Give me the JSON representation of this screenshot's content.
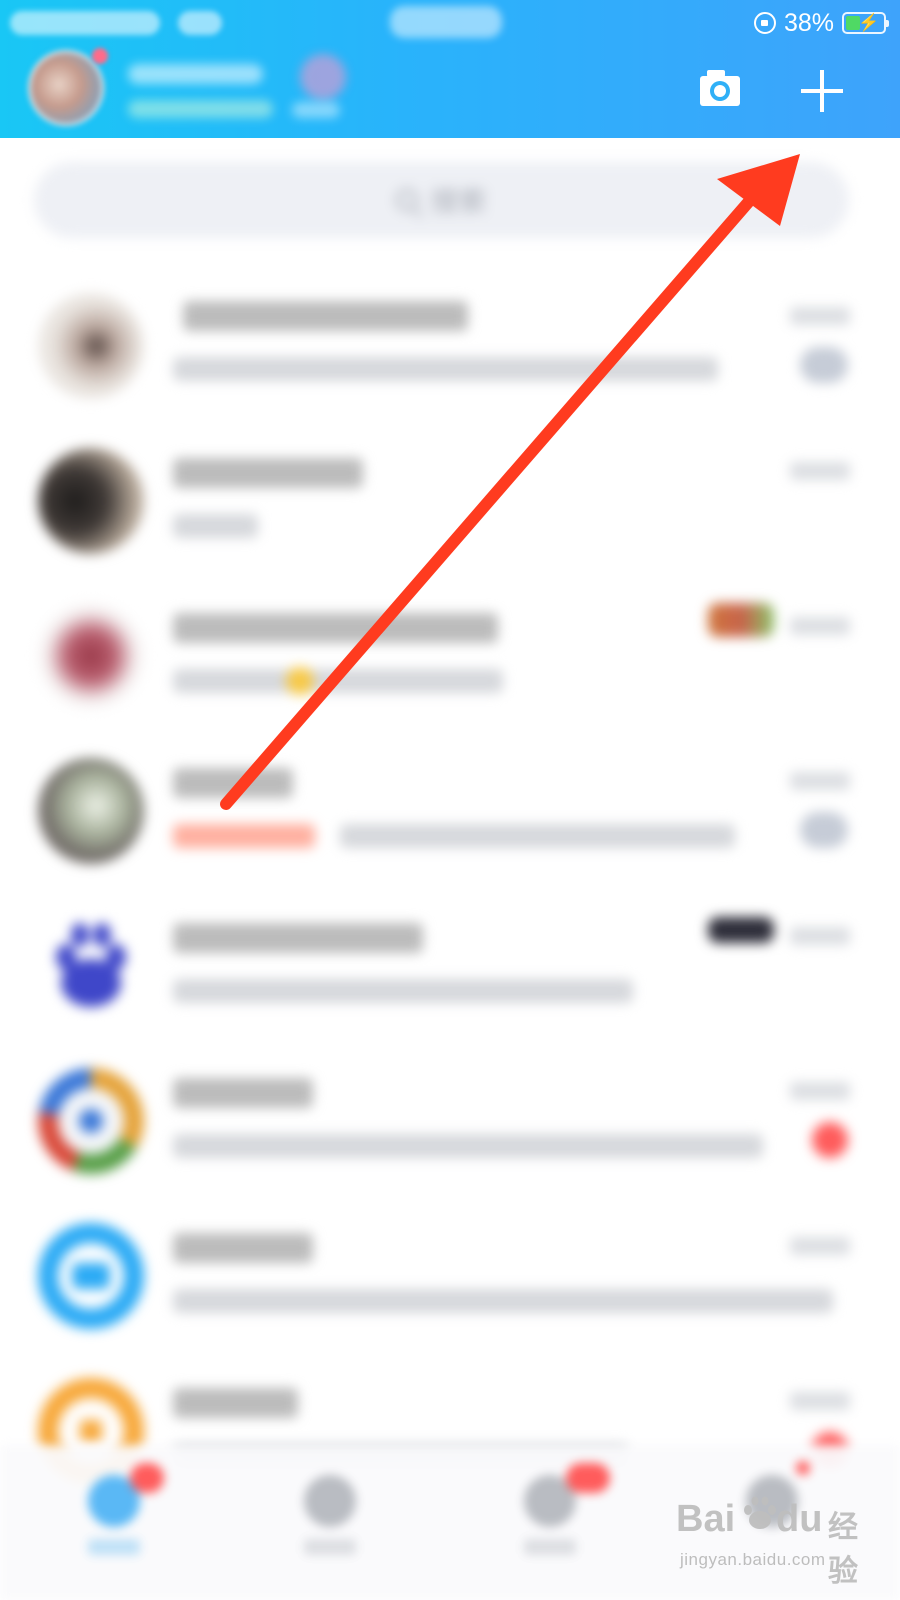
{
  "status_bar": {
    "battery_percent": "38%",
    "battery_level": 0.38,
    "icons": [
      "orientation-lock-icon",
      "battery-icon"
    ]
  },
  "header": {
    "accent_color": "#29b3fb",
    "actions": [
      {
        "name": "camera-icon"
      },
      {
        "name": "plus-icon"
      }
    ]
  },
  "search": {
    "placeholder": "搜索"
  },
  "chats": [],
  "tabbar": {
    "tabs": []
  },
  "annotation": {
    "arrow_color": "#ff3b1f"
  },
  "watermark": {
    "brand": "Bai",
    "brand_suffix": "du",
    "brand_cn": "经验",
    "url": "jingyan.baidu.com"
  }
}
